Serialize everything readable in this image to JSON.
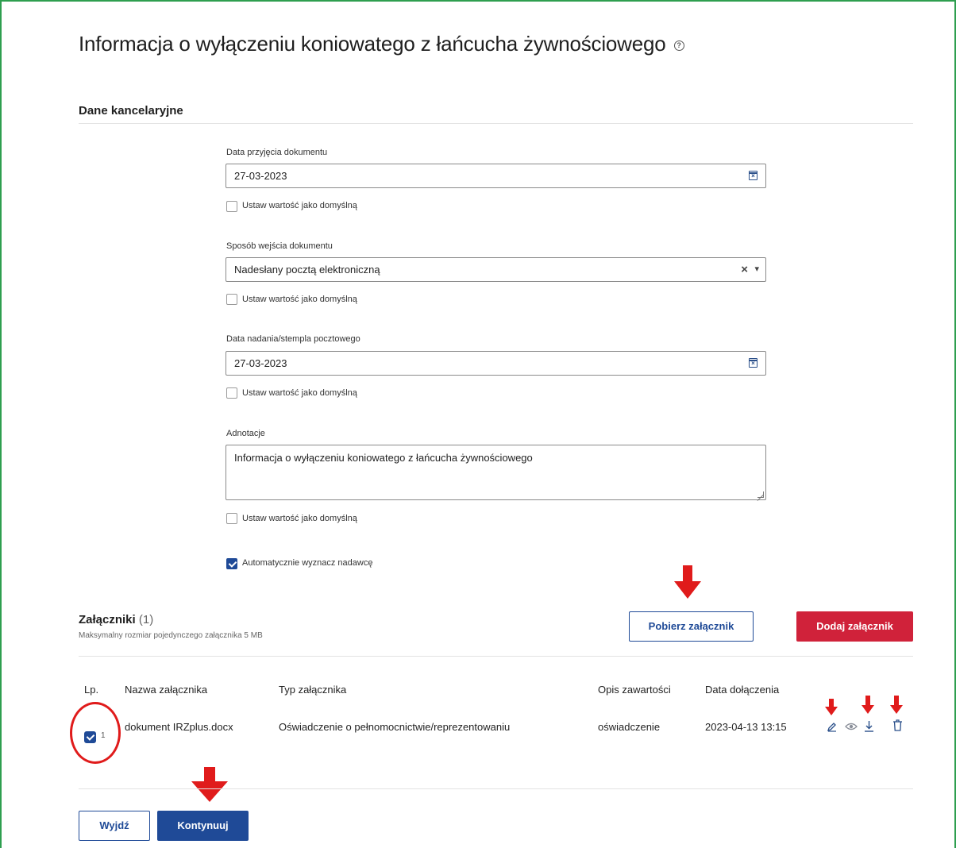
{
  "page": {
    "title": "Informacja o wyłączeniu koniowatego z łańcucha żywnościowego",
    "help_icon": "question-circle-icon"
  },
  "section": {
    "title": "Dane kancelaryjne"
  },
  "fields": {
    "data_przyjecia": {
      "label": "Data przyjęcia dokumentu",
      "value": "27-03-2023",
      "default_label": "Ustaw wartość jako domyślną",
      "icon": "calendar-icon"
    },
    "sposob_wejscia": {
      "label": "Sposób wejścia dokumentu",
      "value": "Nadesłany pocztą elektroniczną",
      "default_label": "Ustaw wartość jako domyślną",
      "clear_icon": "×",
      "dropdown_icon": "▾"
    },
    "data_nadania": {
      "label": "Data nadania/stempla pocztowego",
      "value": "27-03-2023",
      "default_label": "Ustaw wartość jako domyślną",
      "icon": "calendar-icon"
    },
    "adnotacje": {
      "label": "Adnotacje",
      "value": "Informacja o wyłączeniu koniowatego z łańcucha żywnościowego",
      "default_label": "Ustaw wartość jako domyślną"
    },
    "auto_nadawca": {
      "label": "Automatycznie wyznacz nadawcę",
      "checked": true
    }
  },
  "attachments": {
    "title": "Załączniki",
    "count": "(1)",
    "subtitle": "Maksymalny rozmiar pojedynczego załącznika 5 MB",
    "download_button": "Pobierz załącznik",
    "add_button": "Dodaj załącznik",
    "columns": [
      "Lp.",
      "Nazwa załącznika",
      "Typ załącznika",
      "Opis zawartości",
      "Data dołączenia"
    ],
    "rows": [
      {
        "lp": "1",
        "checked": true,
        "name": "dokument IRZplus.docx",
        "type": "Oświadczenie o pełnomocnictwie/reprezentowaniu",
        "description": "oświadczenie",
        "date": "2023-04-13 13:15",
        "actions": [
          "edit-icon",
          "view-icon",
          "download-icon",
          "delete-icon"
        ]
      }
    ]
  },
  "footer": {
    "exit_button": "Wyjdź",
    "continue_button": "Kontynuuj"
  },
  "colors": {
    "primary": "#1f4a97",
    "danger": "#d0223a",
    "annotation": "#e01b1b",
    "frame": "#2e9e4f"
  }
}
